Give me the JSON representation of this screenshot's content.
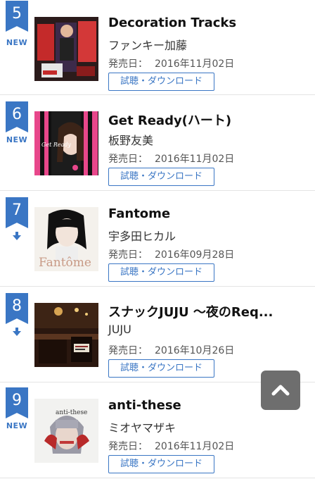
{
  "items": [
    {
      "rank": "5",
      "trend": "new",
      "trend_label": "NEW",
      "title": "Decoration Tracks",
      "artist": "ファンキー加藤",
      "release_label": "発売日：",
      "release_date": "2016年11月02日",
      "button_label": "試聴・ダウンロード"
    },
    {
      "rank": "6",
      "trend": "new",
      "trend_label": "NEW",
      "title": "Get Ready(ハート)",
      "artist": "板野友美",
      "release_label": "発売日：",
      "release_date": "2016年11月02日",
      "button_label": "試聴・ダウンロード"
    },
    {
      "rank": "7",
      "trend": "down",
      "trend_label": "",
      "title": "Fantome",
      "artist": "宇多田ヒカル",
      "release_label": "発売日：",
      "release_date": "2016年09月28日",
      "button_label": "試聴・ダウンロード"
    },
    {
      "rank": "8",
      "trend": "down",
      "trend_label": "",
      "title": "スナックJUJU ～夜のReq...",
      "artist": "JUJU",
      "release_label": "発売日：",
      "release_date": "2016年10月26日",
      "button_label": "試聴・ダウンロード"
    },
    {
      "rank": "9",
      "trend": "new",
      "trend_label": "NEW",
      "title": "anti-these",
      "artist": "ミオヤマザキ",
      "release_label": "発売日：",
      "release_date": "2016年11月02日",
      "button_label": "試聴・ダウンロード"
    }
  ],
  "covers": [
    {
      "icon": "album-cover-decoration-tracks",
      "text": ""
    },
    {
      "icon": "album-cover-get-ready",
      "text": "Get Ready"
    },
    {
      "icon": "album-cover-fantome",
      "text": "Fantôme"
    },
    {
      "icon": "album-cover-snack-juju",
      "text": ""
    },
    {
      "icon": "album-cover-anti-these",
      "text": "anti-these"
    }
  ],
  "scroll_top": {
    "icon": "chevron-up-icon"
  },
  "colors": {
    "accent": "#3a76c4",
    "scroll_button": "#6e6e6e",
    "divider": "#e4e4e4"
  }
}
